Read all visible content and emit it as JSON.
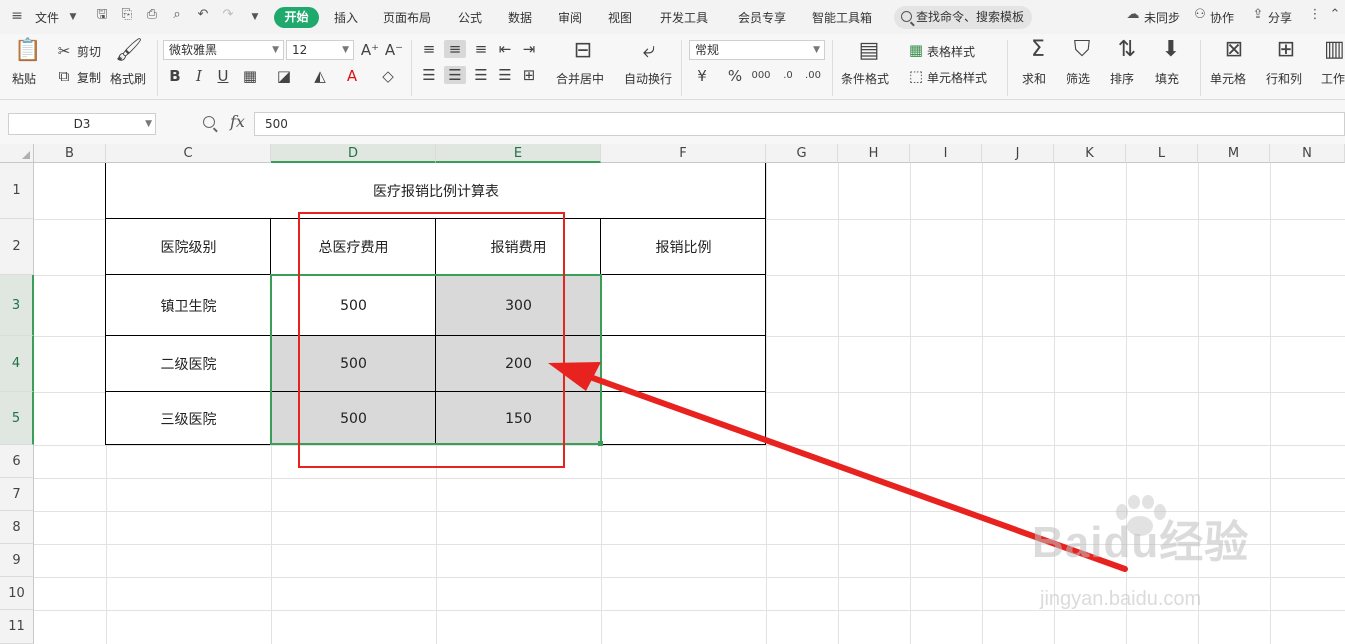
{
  "menubar": {
    "file_label": "文件",
    "tabs": [
      "开始",
      "插入",
      "页面布局",
      "公式",
      "数据",
      "审阅",
      "视图",
      "开发工具",
      "会员专享",
      "智能工具箱"
    ],
    "search_placeholder": "查找命令、搜索模板",
    "sync_label": "未同步",
    "collab_label": "协作",
    "share_label": "分享"
  },
  "ribbon": {
    "paste": "粘贴",
    "cut": "剪切",
    "copy": "复制",
    "format_painter": "格式刷",
    "font_name": "微软雅黑",
    "font_size": "12",
    "merge_center": "合并居中",
    "wrap_text": "自动换行",
    "number_format": "常规",
    "conditional_format": "条件格式",
    "table_style": "表格样式",
    "cell_style": "单元格样式",
    "sum": "求和",
    "filter": "筛选",
    "sort": "排序",
    "fill": "填充",
    "cell": "单元格",
    "row_col": "行和列",
    "worksheet": "工作"
  },
  "formula_bar": {
    "name_box": "D3",
    "fx_label": "fx",
    "content": "500"
  },
  "grid": {
    "columns": [
      "B",
      "C",
      "D",
      "E",
      "F",
      "G",
      "H",
      "I",
      "J",
      "K",
      "L",
      "M",
      "N"
    ],
    "rows": [
      "1",
      "2",
      "3",
      "4",
      "5",
      "6",
      "7",
      "8",
      "9",
      "10",
      "11"
    ]
  },
  "table": {
    "title": "医疗报销比例计算表",
    "headers": [
      "医院级别",
      "总医疗费用",
      "报销费用",
      "报销比例"
    ],
    "rows": [
      {
        "level": "镇卫生院",
        "total": "500",
        "reimburse": "300",
        "ratio": ""
      },
      {
        "level": "二级医院",
        "total": "500",
        "reimburse": "200",
        "ratio": ""
      },
      {
        "level": "三级医院",
        "total": "500",
        "reimburse": "150",
        "ratio": ""
      }
    ]
  },
  "watermark": {
    "brand": "Baidu经验",
    "url": "jingyan.baidu.com"
  },
  "colors": {
    "accent_green": "#1fa96d",
    "selection_green": "#3a9e58",
    "annotation_red": "#e8231f",
    "shade_gray": "#d9d9d9"
  }
}
